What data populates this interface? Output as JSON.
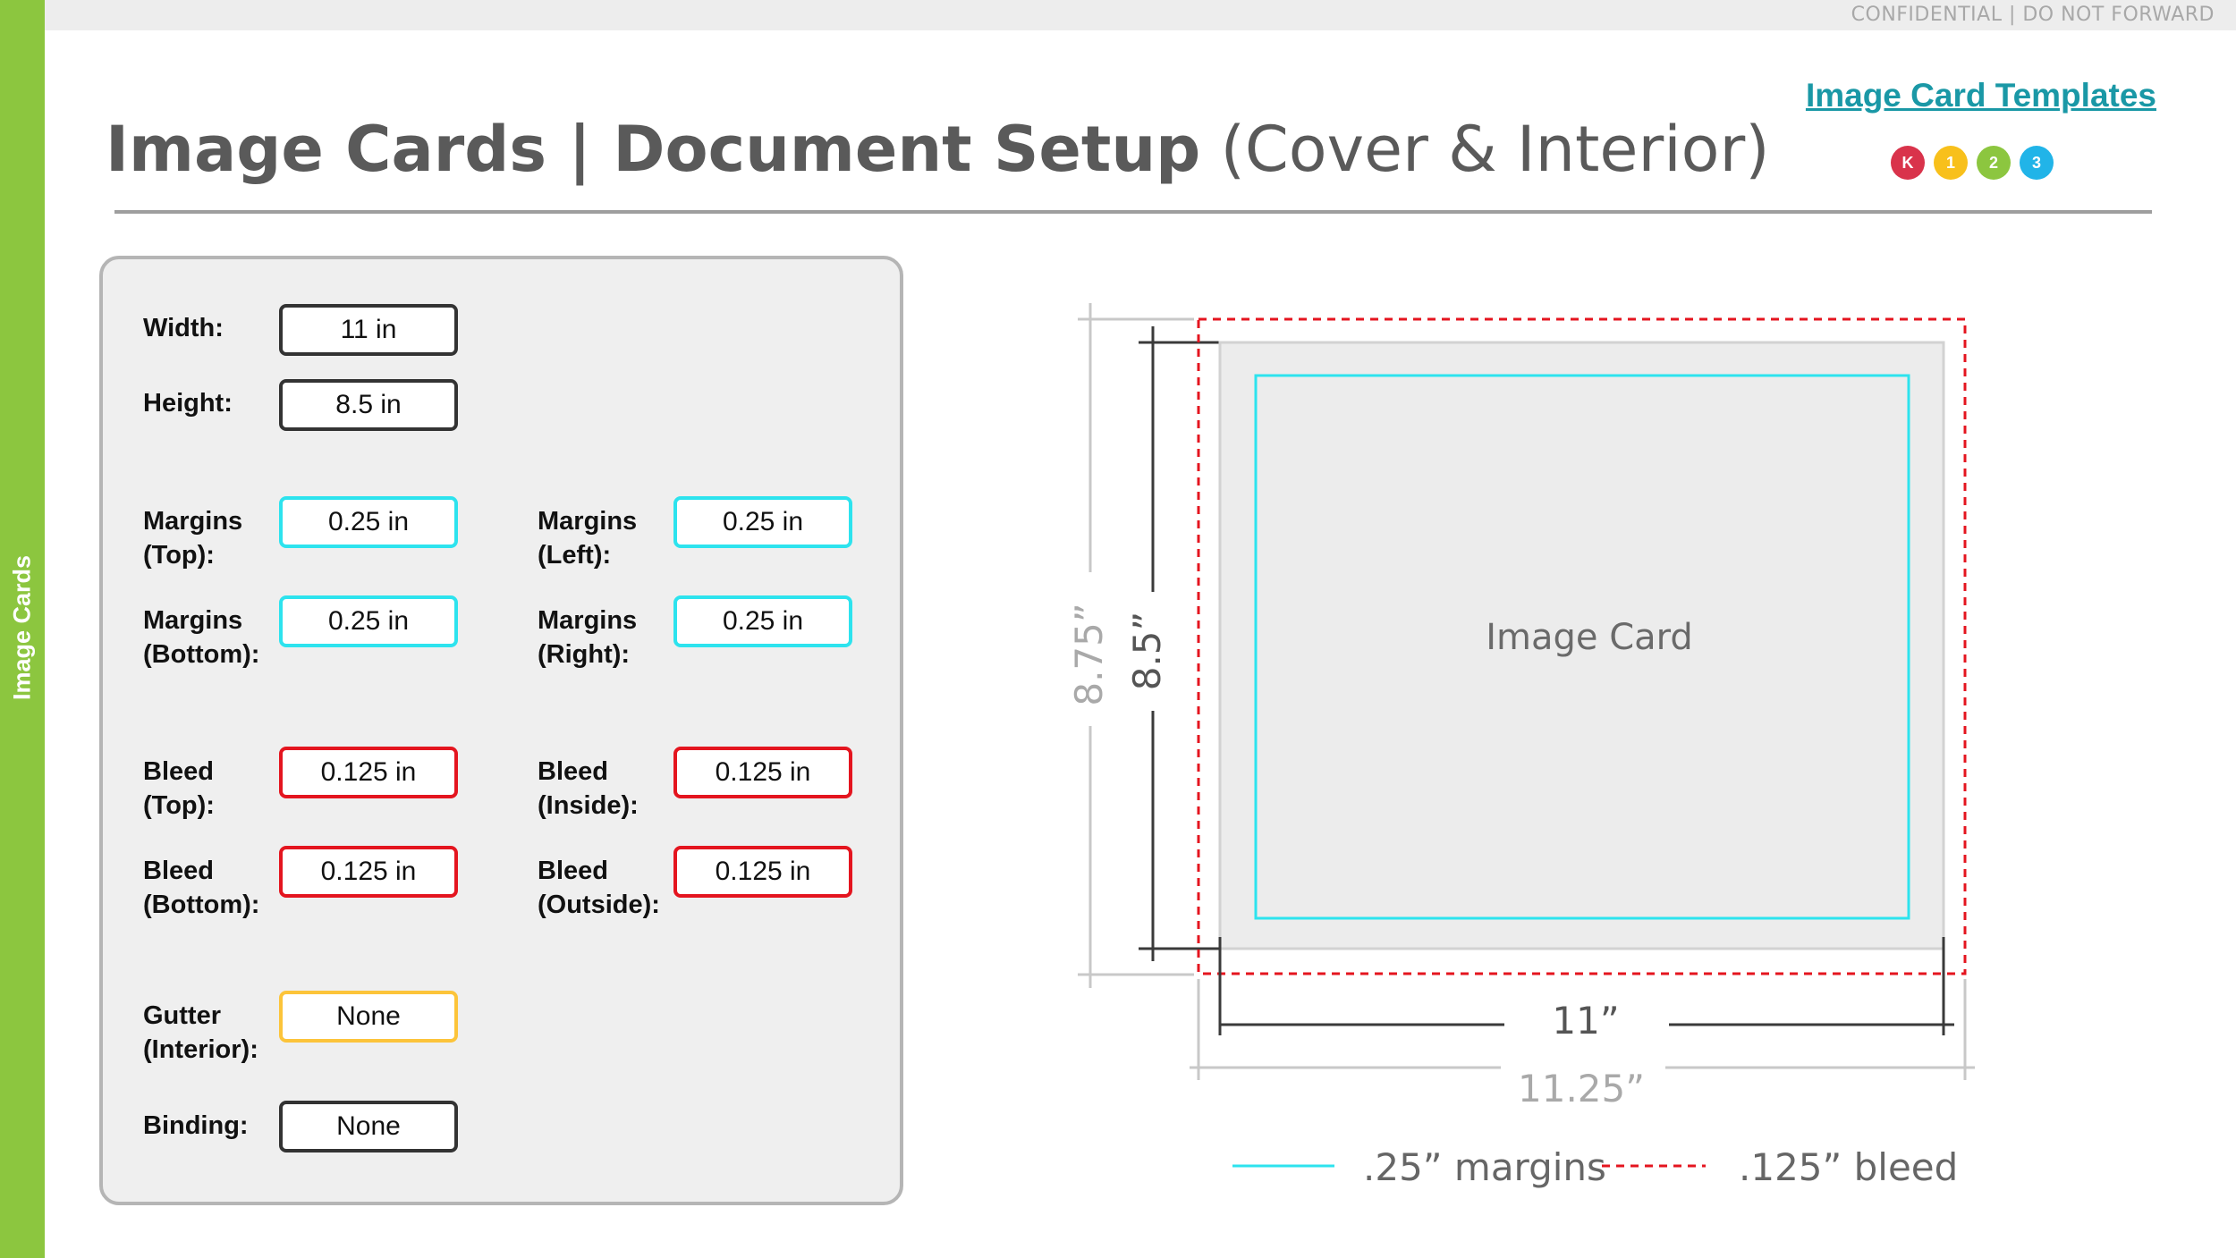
{
  "header": {
    "confidential": "CONFIDENTIAL | DO NOT FORWARD",
    "title_bold": "Image Cards | Document Setup",
    "title_light": "(Cover & Interior)",
    "templates_link": "Image Card Templates",
    "badges": [
      {
        "label": "K",
        "color": "#d9334b"
      },
      {
        "label": "1",
        "color": "#f8c01b"
      },
      {
        "label": "2",
        "color": "#8cc63f"
      },
      {
        "label": "3",
        "color": "#21b4e8"
      }
    ]
  },
  "sidebar": {
    "label": "Image Cards"
  },
  "fields": {
    "width": {
      "label": "Width:",
      "value": "11 in"
    },
    "height": {
      "label": "Height:",
      "value": "8.5 in"
    },
    "margins_top": {
      "label1": "Margins",
      "label2": "(Top):",
      "value": "0.25 in"
    },
    "margins_left": {
      "label1": "Margins",
      "label2": "(Left):",
      "value": "0.25 in"
    },
    "margins_bottom": {
      "label1": "Margins",
      "label2": "(Bottom):",
      "value": "0.25 in"
    },
    "margins_right": {
      "label1": "Margins",
      "label2": "(Right):",
      "value": "0.25 in"
    },
    "bleed_top": {
      "label1": "Bleed",
      "label2": "(Top):",
      "value": "0.125 in"
    },
    "bleed_inside": {
      "label1": "Bleed",
      "label2": "(Inside):",
      "value": "0.125 in"
    },
    "bleed_bottom": {
      "label1": "Bleed",
      "label2": "(Bottom):",
      "value": "0.125 in"
    },
    "bleed_outside": {
      "label1": "Bleed",
      "label2": "(Outside):",
      "value": "0.125 in"
    },
    "gutter": {
      "label1": "Gutter",
      "label2": "(Interior):",
      "value": "None"
    },
    "binding": {
      "label": "Binding:",
      "value": "None"
    }
  },
  "diagram": {
    "card_label": "Image Card",
    "trim_width": "11”",
    "bleed_width": "11.25”",
    "trim_height": "8.5”",
    "bleed_height": "8.75”",
    "legend_margins": ".25” margins",
    "legend_bleed": ".125” bleed",
    "colors": {
      "margin": "#2de3ee",
      "bleed": "#e4151f",
      "page": "#ececec"
    }
  }
}
